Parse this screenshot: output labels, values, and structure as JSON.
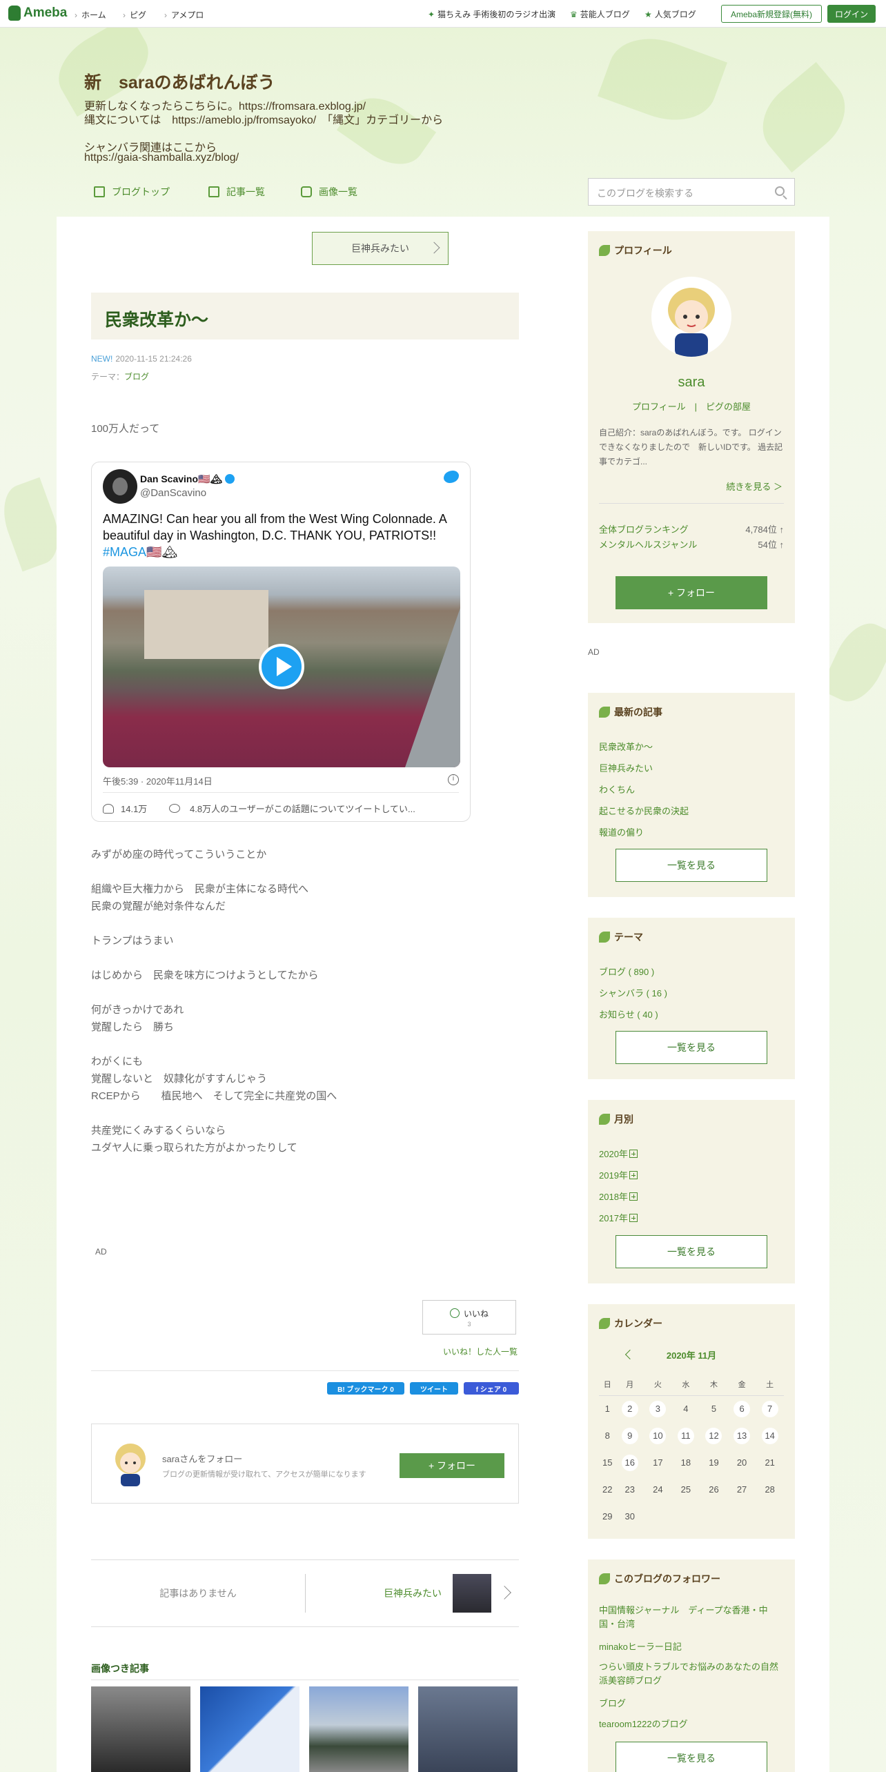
{
  "topbar": {
    "logo": "Ameba",
    "nav": [
      "ホーム",
      "ピグ",
      "アメプロ"
    ],
    "links": [
      "猫ちえみ 手術後初のラジオ出演",
      "芸能人ブログ",
      "人気ブログ"
    ],
    "register": "Ameba新規登録(無料)",
    "login": "ログイン"
  },
  "header": {
    "title": "新　saraのあばれんぼう",
    "desc": [
      "更新しなくなったらこちらに。https://fromsara.exblog.jp/",
      "縄文については　https://ameblo.jp/fromsayoko/　「縄文」カテゴリーから",
      "",
      "シャンバラ関連はここから",
      "https://gaia-shamballa.xyz/blog/"
    ],
    "nav": [
      "ブログトップ",
      "記事一覧",
      "画像一覧"
    ],
    "search_placeholder": "このブログを検索する"
  },
  "article": {
    "prev_label": "巨神兵みたい",
    "title": "民衆改革か～",
    "new": "NEW!",
    "date": "2020-11-15 21:24:26",
    "theme_label": "テーマ：",
    "theme": "ブログ",
    "intro": "100万人だって",
    "tweet": {
      "name": "Dan Scavino🇺🇸🏔",
      "handle": "@DanScavino",
      "text": "AMAZING! Can hear you all from the West Wing Colonnade. A beautiful day in Washington, D.C. THANK YOU, PATRIOTS!! ",
      "hashtag": "#MAGA",
      "text_end": "🇺🇸🏔",
      "time": "午後5:39 · 2020年11月14日",
      "likes": "14.1万",
      "replies": "4.8万人のユーザーがこの話題についてツイートしてい..."
    },
    "body": [
      "みずがめ座の時代ってこういうことか",
      "",
      "組織や巨大権力から　民衆が主体になる時代へ",
      "民衆の覚醒が絶対条件なんだ",
      "",
      "トランプはうまい",
      "",
      "はじめから　民衆を味方につけようとしてたから",
      "",
      "何がきっかけであれ",
      "覚醒したら　勝ち",
      "",
      "わがくにも",
      "覚醒しないと　奴隷化がすすんじゃう",
      "RCEPから　　植民地へ　そして完全に共産党の国へ",
      "",
      "共産党にくみするくらいなら",
      "ユダヤ人に乗っ取られた方がよかったりして"
    ],
    "ad": "AD",
    "like": "いいね",
    "like_count": "3",
    "like_list": "いいね！した人一覧",
    "share": [
      "B! ブックマーク  0",
      "ツイート",
      "f シェア 0"
    ],
    "follow_name": "saraさんをフォロー",
    "follow_sub": "ブログの更新情報が受け取れて、アクセスが簡単になります",
    "follow_btn": "+ フォロー",
    "no_article": "記事はありません",
    "next_label": "巨神兵みたい",
    "images_head": "画像つき記事"
  },
  "sidebar": {
    "profile": {
      "head": "プロフィール",
      "name": "sara",
      "links": "プロフィール　|　ピグの部屋",
      "desc": "自己紹介：saraのあばれんぼう。です。 ログインできなくなりましたので　新しいIDです。 過去記事でカテゴ...",
      "more": "続きを見る ＞",
      "ranks": [
        {
          "label": "全体ブログランキング",
          "value": "4,784位 ↑"
        },
        {
          "label": "メンタルヘルスジャンル",
          "value": "54位 ↑"
        }
      ],
      "follow": "+ フォロー"
    },
    "ad": "AD",
    "recent": {
      "head": "最新の記事",
      "items": [
        "民衆改革か～",
        "巨神兵みたい",
        "わくちん",
        "起こせるか民衆の決起",
        "報道の偏り"
      ],
      "more": "一覧を見る"
    },
    "theme": {
      "head": "テーマ",
      "items": [
        "ブログ ( 890 )",
        "シャンバラ ( 16 )",
        "お知らせ ( 40 )"
      ],
      "more": "一覧を見る"
    },
    "monthly": {
      "head": "月別",
      "items": [
        "2020年",
        "2019年",
        "2018年",
        "2017年"
      ],
      "more": "一覧を見る"
    },
    "calendar": {
      "head": "カレンダー",
      "month": "2020年 11月",
      "days": [
        "日",
        "月",
        "火",
        "水",
        "木",
        "金",
        "土"
      ],
      "weeks": [
        [
          "1",
          "2",
          "3",
          "4",
          "5",
          "6",
          "7"
        ],
        [
          "8",
          "9",
          "10",
          "11",
          "12",
          "13",
          "14"
        ],
        [
          "15",
          "16",
          "17",
          "18",
          "19",
          "20",
          "21"
        ],
        [
          "22",
          "23",
          "24",
          "25",
          "26",
          "27",
          "28"
        ],
        [
          "29",
          "30",
          "",
          "",
          "",
          "",
          ""
        ]
      ],
      "has": [
        "2",
        "3",
        "6",
        "7",
        "9",
        "10",
        "11",
        "12",
        "13",
        "14",
        "16"
      ]
    },
    "followers": {
      "head": "このブログのフォロワー",
      "items": [
        "中国情報ジャーナル　ディープな香港・中国・台湾",
        "minakoヒーラー日記",
        "つらい頭皮トラブルでお悩みのあなたの自然派美容師ブログ",
        "ブログ",
        "tearoom1222のブログ"
      ],
      "more": "一覧を見る"
    }
  }
}
